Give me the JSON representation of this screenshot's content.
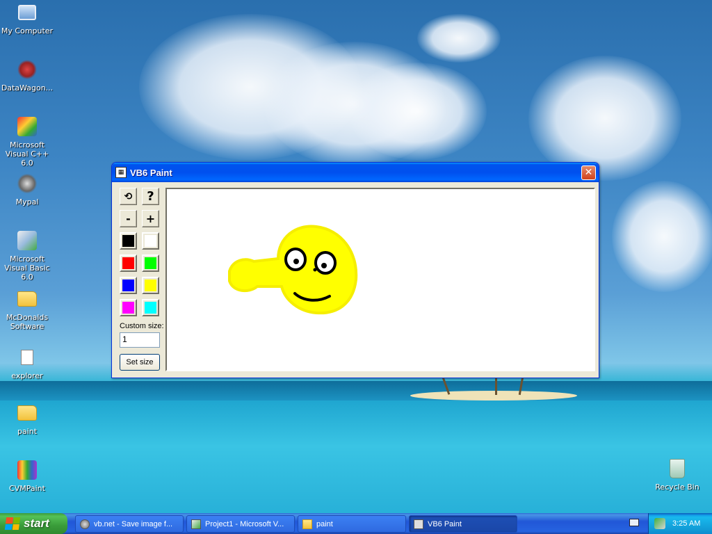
{
  "desktop": {
    "icons": [
      {
        "label": "My Computer",
        "icon": "computer-icon"
      },
      {
        "label": "DataWagon...",
        "icon": "shortcut-icon"
      },
      {
        "label": "Microsoft Visual C++ 6.0",
        "icon": "visual-cpp-icon"
      },
      {
        "label": "Mypal",
        "icon": "mypal-icon"
      },
      {
        "label": "Microsoft Visual Basic 6.0",
        "icon": "visual-basic-icon"
      },
      {
        "label": "McDonalds Software",
        "icon": "folder-icon"
      },
      {
        "label": "explorer",
        "icon": "file-icon"
      },
      {
        "label": "paint",
        "icon": "folder-icon"
      },
      {
        "label": "CVMPaint",
        "icon": "paint-app-icon"
      }
    ],
    "recycle_bin": {
      "label": "Recycle Bin",
      "icon": "recycle-bin-icon"
    }
  },
  "window": {
    "title": "VB6 Paint",
    "close_label": "✕",
    "tools": {
      "clear_label": "⟲",
      "help_label": "?",
      "minus_label": "-",
      "plus_label": "+"
    },
    "palette": [
      {
        "name": "black",
        "color": "#000000"
      },
      {
        "name": "white",
        "color": "#ffffff"
      },
      {
        "name": "red",
        "color": "#ff0000"
      },
      {
        "name": "green",
        "color": "#00ff00"
      },
      {
        "name": "blue",
        "color": "#0000ff"
      },
      {
        "name": "yellow",
        "color": "#ffff00"
      },
      {
        "name": "magenta",
        "color": "#ff00ff"
      },
      {
        "name": "cyan",
        "color": "#00ffff"
      }
    ],
    "custom_size_label": "Custom size:",
    "custom_size_value": "1",
    "set_size_label": "Set size"
  },
  "taskbar": {
    "start_label": "start",
    "tasks": [
      {
        "label": "vb.net - Save image f...",
        "active": false
      },
      {
        "label": "Project1 - Microsoft V...",
        "active": false
      },
      {
        "label": "paint",
        "active": false
      },
      {
        "label": "VB6 Paint",
        "active": true
      }
    ],
    "clock": "3:25 AM"
  },
  "colors": {
    "titlebar": "#0053ee",
    "drawing_yellow": "#ffff00",
    "drawing_black": "#000000"
  }
}
